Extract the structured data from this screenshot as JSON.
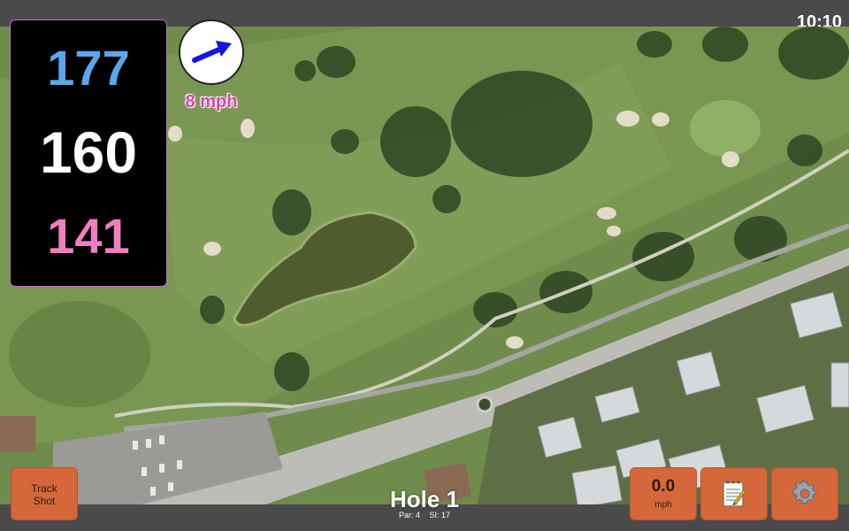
{
  "status": {
    "time": "10:10"
  },
  "distances": {
    "back": "177",
    "middle": "160",
    "front": "141",
    "back_color": "#5aa7ea",
    "middle_color": "#ffffff",
    "front_color": "#f07fc0"
  },
  "wind": {
    "speed": "8 mph",
    "arrow_icon": "wind-direction-arrow-icon",
    "arrow_color": "#1018e0",
    "label_color": "#d63fae"
  },
  "hole": {
    "title": "Hole 1",
    "par": "Par: 4",
    "si": "SI: 17"
  },
  "buttons": {
    "track_shot_line1": "Track",
    "track_shot_line2": "Shot",
    "wind_value": "0.0",
    "wind_unit": "mph",
    "notes_icon": "notepad-icon",
    "settings_icon": "gear-icon",
    "color": "#d4683a"
  }
}
